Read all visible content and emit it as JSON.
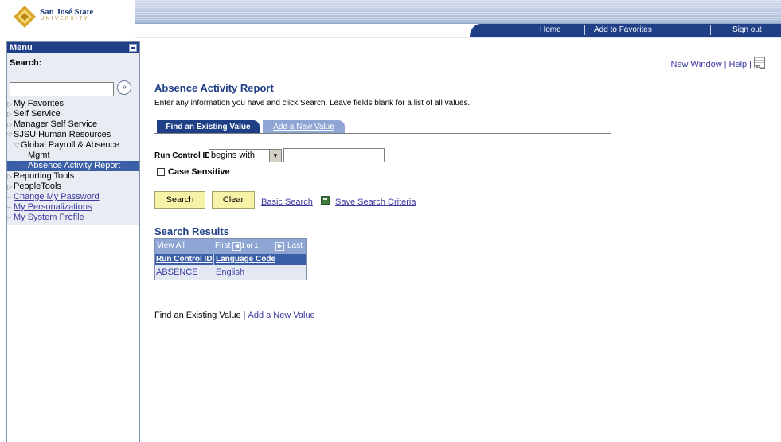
{
  "logo": {
    "name": "San José State",
    "subtitle": "UNIVERSITY"
  },
  "nav": {
    "home": "Home",
    "add_favorites": "Add to Favorites",
    "sign_out": "Sign out"
  },
  "menu": {
    "title": "Menu",
    "search_label": "Search:",
    "search_value": "",
    "items": [
      {
        "label": "My Favorites",
        "kind": "collapsed"
      },
      {
        "label": "Self Service",
        "kind": "collapsed"
      },
      {
        "label": "Manager Self Service",
        "kind": "collapsed"
      },
      {
        "label": "SJSU Human Resources",
        "kind": "expanded"
      },
      {
        "label": "Global Payroll & Absence",
        "kind": "expanded-sub"
      },
      {
        "label": "Mgmt",
        "kind": "continuation"
      },
      {
        "label": "Absence Activity Report",
        "kind": "selected"
      },
      {
        "label": "Reporting Tools",
        "kind": "collapsed"
      },
      {
        "label": "PeopleTools",
        "kind": "collapsed"
      },
      {
        "label": "Change My Password",
        "kind": "link"
      },
      {
        "label": "My Personalizations",
        "kind": "link"
      },
      {
        "label": "My System Profile",
        "kind": "link"
      }
    ]
  },
  "toplinks": {
    "new_window": "New Window",
    "help": "Help",
    "http_icon": "http"
  },
  "page": {
    "title": "Absence Activity Report",
    "instructions": "Enter any information you have and click Search. Leave fields blank for a list of all values."
  },
  "tabs": {
    "find": "Find an Existing Value",
    "add": "Add a New Value"
  },
  "form": {
    "run_control_label": "Run Control ID:",
    "operator": "begins with",
    "run_control_value": "",
    "case_sensitive_label": "Case Sensitive",
    "case_sensitive_checked": false
  },
  "buttons": {
    "search": "Search",
    "clear": "Clear",
    "basic_search": "Basic Search",
    "save_criteria": "Save Search Criteria"
  },
  "results": {
    "title": "Search Results",
    "view_all": "View All",
    "first": "First",
    "pages": "1 of 1",
    "last": "Last",
    "columns": [
      "Run Control ID",
      "Language Code"
    ],
    "rows": [
      [
        "ABSENCE",
        "English"
      ]
    ]
  },
  "bottom": {
    "find": "Find an Existing Value",
    "add": "Add a New Value"
  },
  "colors": {
    "brand_navy": "#1f3f86",
    "tab_inactive": "#8fa6d4",
    "button_yellow": "#f6f3a9"
  }
}
